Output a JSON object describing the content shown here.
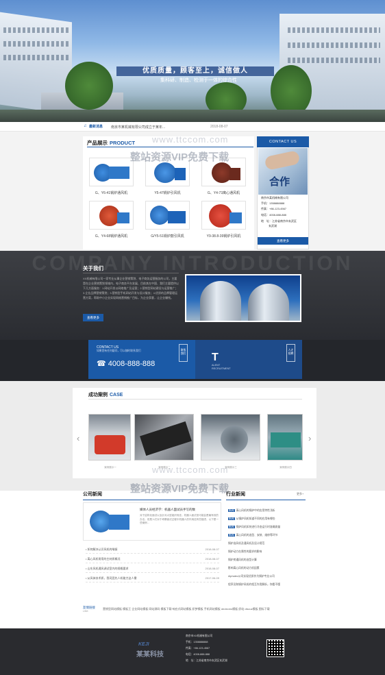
{
  "banner": {
    "slogan": "优质质量，顾客至上，诚信做人",
    "subslogan": "集科研、制造、检测于一体的综合性"
  },
  "ticker": {
    "label": "最新消息",
    "text": "南京市某机械有限公司成立于某年...",
    "date": "2018-08-07"
  },
  "products": {
    "title": "产品展示",
    "title_en": "PRODUCT",
    "items": [
      {
        "label": "G、Y6-41锅炉通风机"
      },
      {
        "label": "Y5-47锅炉引风机"
      },
      {
        "label": "G、Y4-73离心通风机"
      },
      {
        "label": "G、Y4-68锅炉通风机"
      },
      {
        "label": "G/Y5-51锅炉鼓引风机"
      },
      {
        "label": "Y9-38.8-39锅炉引风机"
      }
    ]
  },
  "contact": {
    "header": "CONTACT US",
    "hero_text": "合作",
    "company": "南京市某机械有限公司",
    "mobile": "手机：1358888888",
    "fax": "传真：+86-123-4567",
    "tel": "电话：4008-888-888",
    "address_line1": "地　址：江苏省南京市玄武区",
    "address_line2": "玄武湖",
    "button": "查看更多"
  },
  "watermark": {
    "url": "www.ttccom.com",
    "text": "整站资源VIP免费下载"
  },
  "about": {
    "bg_text": "COMPANY INTRODUCTION",
    "title": "关于我们",
    "text": "XX机械有限公司一家专业从事企业营销策划、电子商务运营服务的公司，主要是在企业营销策划领域内，电子商务平台发展、目前其在中国、我们主要提供以下几方面服务：1.网站开发以网络推广及运营；2.营销型网站建设与运营推广；3.企业品牌营销策划；3.营销型手机网站开发与设计服务；4.优质的品牌管理运营方案，帮助中小企业实现网络营销推广目标，为企业获客，让企业赚钱。",
    "button": "查看更多"
  },
  "contact_strip": {
    "label": "CONTACT US",
    "sub": "如果您有任何疑问，可以随时联系我们",
    "phone": "4008-888-888",
    "btn1": "联系我们",
    "talent_letter": "T",
    "talent_line1": "ALENT",
    "talent_line2": "RECRUITMENT",
    "btn2": "人才招聘"
  },
  "cases": {
    "title": "成功案例",
    "title_en": "CASE",
    "items": [
      {
        "caption": "案例展示一"
      },
      {
        "caption": "案例展示二"
      },
      {
        "caption": "案例展示三"
      },
      {
        "caption": "案例展示四"
      }
    ]
  },
  "news": {
    "title": "公司新闻",
    "title2": "行业新闻",
    "more": "更多+",
    "featured_title": "媒体人员经济学：机器人面试员手写的数",
    "featured_text": "对于结构化面试以及针对大型组织而言，机器人面试官可能会是最有效的办法。但是人们对于考察面试过程中机器人的作用还有些疑虑，以下是一些案例...",
    "list": [
      {
        "title": "如何解决认识风机的喘振",
        "date": "2018-08-07"
      },
      {
        "title": "离心风机常用的主材质概况",
        "date": "2018-08-07"
      },
      {
        "title": "山东风机通风调试室内的规格要求",
        "date": "2018-08-07"
      },
      {
        "title": "从风体技术质，我司团先人机能力这人需",
        "date": "2017-06-09"
      }
    ],
    "industry": [
      {
        "tag": "新闻",
        "title": "离心风机的锅炉中的应用特性浅析"
      },
      {
        "tag": "新闻",
        "title": "从锅炉风机知道不同的应用有哪些"
      },
      {
        "tag": "新闻",
        "title": "锅炉风机如何进行冷态运行时准确测量"
      },
      {
        "tag": "新闻",
        "title": "离心风机的选型、安装、维修等环节"
      },
      {
        "tag": "",
        "title": "锅炉选风机及通风机及设计规范"
      },
      {
        "tag": "",
        "title": "锅炉动力在属性的要求的影响"
      },
      {
        "tag": "",
        "title": "锅炉房通风机的选型计算"
      },
      {
        "tag": "",
        "title": "影响离心风机的动力机因素"
      },
      {
        "tag": "",
        "title": "Alphatec公司实现优质作为锅炉专业公司"
      },
      {
        "tag": "",
        "title": "程序员和锅炉风机的相互作用解析，你看不懂"
      }
    ]
  },
  "links": {
    "label": "友情链接",
    "label_en": "LINK",
    "text": "营销型网站模板  模板王  企业网站模板  网站源码  模板下载  响应式网站模板  织梦模板  手机网站模板  dedecms模板  织站  discuz模板  图标下载"
  },
  "footer": {
    "brand_en": "KEJI",
    "brand_cn": "某某科技",
    "line1": "南京市XX机械有限公司",
    "line2": "手机：1358888888",
    "line3": "传真：+86-123-4567",
    "line4": "电话：4008-888-888",
    "line5": "地　址：江苏省南京市玄武区玄武湖"
  }
}
